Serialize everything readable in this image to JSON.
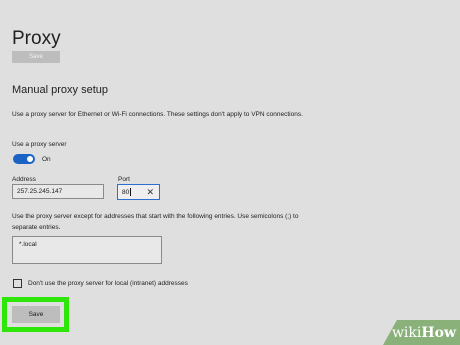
{
  "header": {
    "title": "Proxy",
    "save_label": "Save"
  },
  "manual": {
    "heading": "Manual proxy setup",
    "description": "Use a proxy server for Ethernet or Wi-Fi connections. These settings don't apply to VPN connections.",
    "use_proxy_label": "Use a proxy server",
    "toggle_state": "On",
    "address_label": "Address",
    "address_value": "257.25.245.147",
    "port_label": "Port",
    "port_value": "80",
    "exceptions_description": "Use the proxy server except for addresses that start with the following entries. Use semicolons (;) to separate entries.",
    "exceptions_value": "*.local",
    "local_checkbox_label": "Don't use the proxy server for local (intranet) addresses",
    "local_checkbox_checked": false,
    "save_label": "Save"
  },
  "watermark": {
    "part1": "wiki",
    "part2": "How"
  },
  "colors": {
    "background": "#dfdfdf",
    "accent": "#1b63c4",
    "highlight": "#2ee60a",
    "watermark": "#8ab17a"
  }
}
